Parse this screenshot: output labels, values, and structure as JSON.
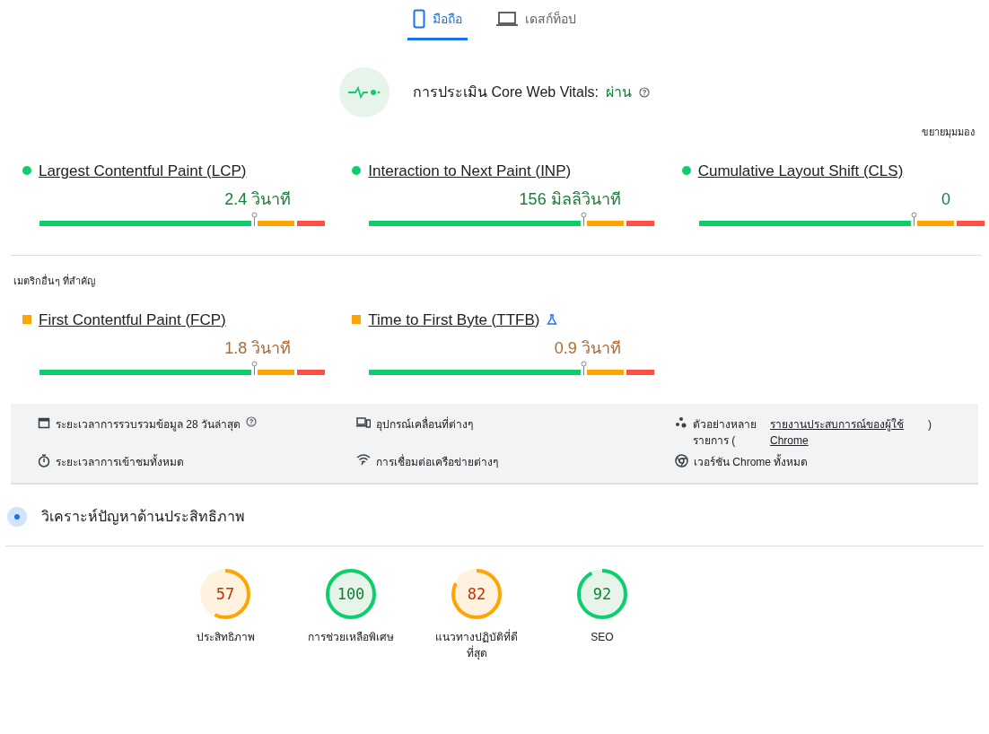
{
  "tabs": [
    {
      "label": "มือถือ",
      "kind": "phone",
      "selected": true
    },
    {
      "label": "เดสก์ท็อป",
      "kind": "laptop",
      "selected": false
    }
  ],
  "assessment": {
    "label": "การประเมิน Core Web Vitals:",
    "result": "ผ่าน"
  },
  "expand_link": "ขยายมุมมอง",
  "core_metrics": [
    {
      "name": "Largest Contentful Paint (LCP)",
      "value": "2.4 วินาที",
      "kind": "good"
    },
    {
      "name": "Interaction to Next Paint (INP)",
      "value": "156 มิลลิวินาที",
      "kind": "good"
    },
    {
      "name": "Cumulative Layout Shift (CLS)",
      "value": "0",
      "kind": "good"
    }
  ],
  "other_title": "เมตริกอื่นๆ ที่สำคัญ",
  "other_metrics": [
    {
      "name": "First Contentful Paint (FCP)",
      "value": "1.8 วินาที",
      "kind": "average",
      "experimental": false
    },
    {
      "name": "Time to First Byte (TTFB)",
      "value": "0.9 วินาที",
      "kind": "average",
      "experimental": true
    }
  ],
  "info": [
    {
      "kind": "calendar",
      "text": "ระยะเวลาการรวบรวมข้อมูล 28 วันล่าสุด",
      "help": true
    },
    {
      "kind": "devices",
      "text": "อุปกรณ์เคลื่อนที่ต่างๆ",
      "help": false
    },
    {
      "kind": "samples",
      "text": "ตัวอย่างหลาย รายการ (",
      "link": "รายงานประสบการณ์ของผู้ใช้ Chrome",
      "suffix": ")",
      "help": false
    },
    {
      "kind": "timer",
      "text": "ระยะเวลาการเข้าชมทั้งหมด",
      "help": false
    },
    {
      "kind": "network",
      "text": "การเชื่อมต่อเครือข่ายต่างๆ",
      "help": false
    },
    {
      "kind": "chrome",
      "text": "เวอร์ชัน Chrome ทั้งหมด",
      "help": false
    }
  ],
  "diagnose_title": "วิเคราะห์ปัญหาด้านประสิทธิภาพ",
  "scores": [
    {
      "score": "57",
      "label": "ประสิทธิภาพ",
      "kind": "average"
    },
    {
      "score": "100",
      "label": "การช่วยเหลือพิเศษ",
      "kind": "good"
    },
    {
      "score": "82",
      "label": "แนวทางปฏิบัติที่ดีที่สุด",
      "kind": "average"
    },
    {
      "score": "92",
      "label": "SEO",
      "kind": "good"
    }
  ]
}
